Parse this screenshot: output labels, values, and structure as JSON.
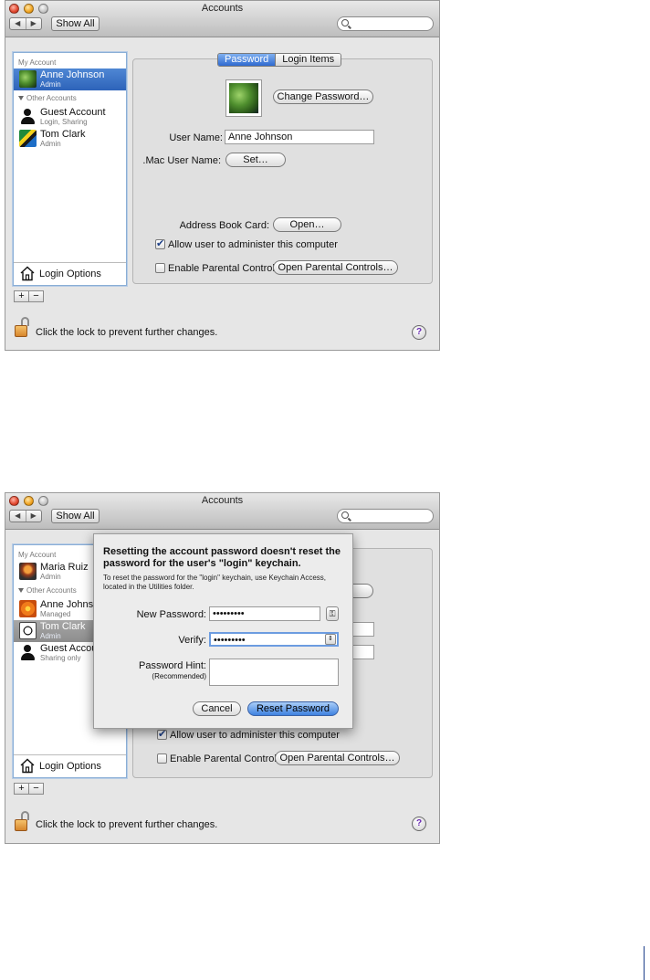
{
  "window1": {
    "title": "Accounts",
    "show_all_label": "Show All",
    "nav_back": "◀",
    "nav_forward": "▶",
    "search_placeholder": "",
    "sidebar": {
      "my_account_header": "My Account",
      "other_accounts_header": "Other Accounts",
      "accounts": [
        {
          "name": "Anne Johnson",
          "role": "Admin"
        },
        {
          "name": "Guest Account",
          "role": "Login, Sharing"
        },
        {
          "name": "Tom Clark",
          "role": "Admin"
        }
      ],
      "login_options_label": "Login Options",
      "add_label": "+",
      "remove_label": "−"
    },
    "tabs": [
      "Password",
      "Login Items"
    ],
    "change_password_label": "Change Password…",
    "user_name_label": "User Name:",
    "user_name_value": "Anne Johnson",
    "mac_user_name_label": ".Mac User Name:",
    "set_label": "Set…",
    "address_book_card_label": "Address Book Card:",
    "open_label": "Open…",
    "allow_admin_label": "Allow user to administer this computer",
    "allow_admin_checked": true,
    "parental_controls_label": "Enable Parental Controls",
    "parental_controls_checked": false,
    "open_parental_controls_label": "Open Parental Controls…",
    "lock_text": "Click the lock to prevent further changes.",
    "help_label": "?"
  },
  "window2": {
    "title": "Accounts",
    "show_all_label": "Show All",
    "nav_back": "◀",
    "nav_forward": "▶",
    "sidebar": {
      "my_account_header": "My Account",
      "other_accounts_header": "Other Accounts",
      "accounts": [
        {
          "name": "Maria Ruiz",
          "role": "Admin"
        },
        {
          "name": "Anne Johnso",
          "role": "Managed"
        },
        {
          "name": "Tom Clark",
          "role": "Admin"
        },
        {
          "name": "Guest Accou",
          "role": "Sharing only"
        }
      ],
      "login_options_label": "Login Options",
      "add_label": "+",
      "remove_label": "−"
    },
    "sheet": {
      "message": "Resetting the account password doesn't reset the password for the user's \"login\" keychain.",
      "info": "To reset the password for the \"login\" keychain, use Keychain Access, located in the Utilities folder.",
      "new_password_label": "New Password:",
      "new_password_value": "•••••••••",
      "verify_label": "Verify:",
      "verify_value": "•••••••••",
      "hint_label": "Password Hint:",
      "hint_sublabel": "(Recommended)",
      "hint_value": "",
      "cancel_label": "Cancel",
      "reset_label": "Reset Password"
    },
    "allow_admin_label": "Allow user to administer this computer",
    "allow_admin_checked": true,
    "parental_controls_label": "Enable Parental Controls",
    "parental_controls_checked": false,
    "open_parental_controls_label": "Open Parental Controls…",
    "lock_text": "Click the lock to prevent further changes.",
    "help_label": "?"
  }
}
